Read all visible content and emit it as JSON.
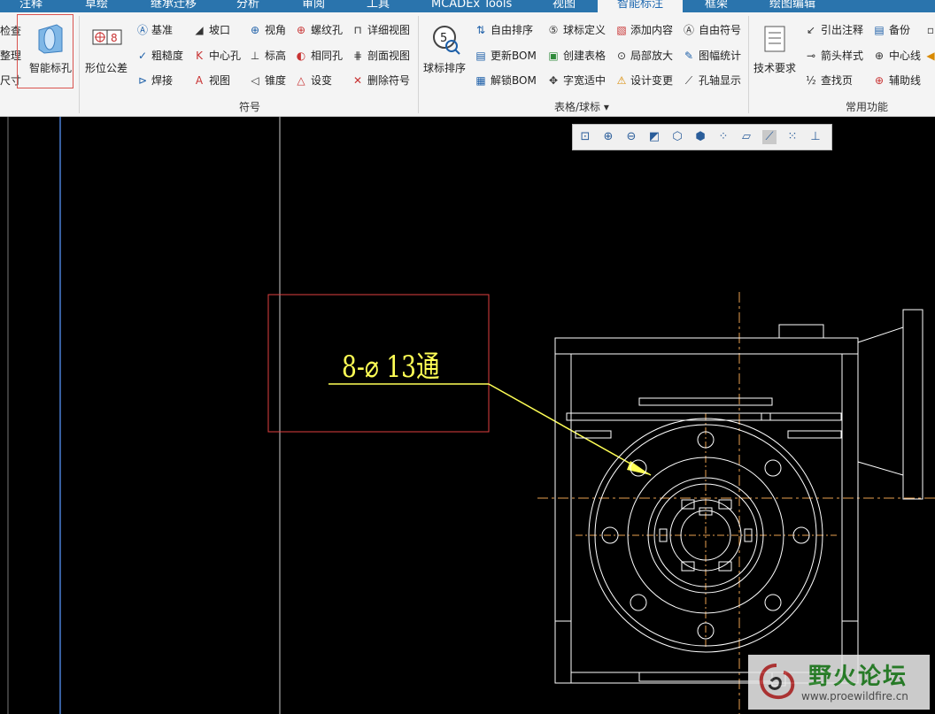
{
  "tabs": [
    "注释",
    "草绘",
    "继承迁移",
    "分析",
    "审阅",
    "工具",
    "MCADEx Tools",
    "视图",
    "智能标注",
    "框架",
    "绘图编辑"
  ],
  "active_tab": "智能标注",
  "ribbon": {
    "left_partial": [
      "检查",
      "整理",
      "尺寸"
    ],
    "smart_hole_label": "智能标孔",
    "form_tol_label": "形位公差",
    "symbol_items": [
      "基准",
      "坡口",
      "视角",
      "螺纹孔",
      "详细视图",
      "粗糙度",
      "中心孔",
      "标高",
      "相同孔",
      "剖面视图",
      "焊接",
      "视图",
      "锥度",
      "设变",
      "删除符号"
    ],
    "symbol_group": "符号",
    "balloon_sort_label": "球标排序",
    "bom_items": [
      "自由排序",
      "更新BOM",
      "解锁BOM",
      "球标定义",
      "创建表格",
      "字宽适中",
      "添加内容",
      "局部放大",
      "设计变更",
      "自由符号",
      "图幅统计",
      "孔轴显示"
    ],
    "table_group": "表格/球标",
    "tech_req_label": "技术要求",
    "common_items": [
      "引出注释",
      "备份",
      "箭头样式",
      "中心线",
      "查找页",
      "辅助线"
    ],
    "common_group": "常用功能"
  },
  "drawing": {
    "annotation": "8-⌀ 13通",
    "line_color": "#ffffff",
    "annot_color": "#ffff55",
    "centerline_color": "#e8a050",
    "border_color": "#4a7fd4"
  },
  "watermark": {
    "title": "野火论坛",
    "url": "www.proewildfire.cn"
  }
}
